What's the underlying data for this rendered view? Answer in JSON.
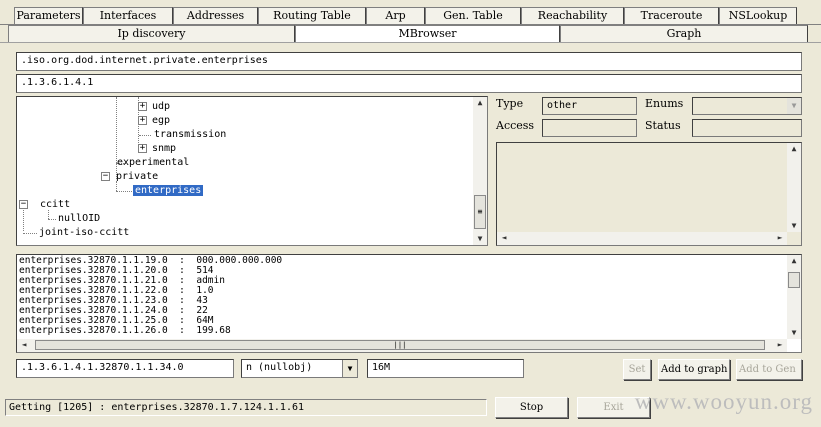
{
  "tabs_top": [
    {
      "label": "Parameters"
    },
    {
      "label": "Interfaces"
    },
    {
      "label": "Addresses"
    },
    {
      "label": "Routing Table"
    },
    {
      "label": "Arp"
    },
    {
      "label": "Gen. Table"
    },
    {
      "label": "Reachability"
    },
    {
      "label": "Traceroute"
    },
    {
      "label": "NSLookup"
    }
  ],
  "tabs_second": [
    {
      "label": "Ip discovery"
    },
    {
      "label": "MBrowser"
    },
    {
      "label": "Graph"
    }
  ],
  "oid_name": ".iso.org.dod.internet.private.enterprises",
  "oid_numeric": ".1.3.6.1.4.1",
  "tree": {
    "udp": "udp",
    "egp": "egp",
    "transmission": "transmission",
    "snmp": "snmp",
    "experimental": "experimental",
    "private": "private",
    "enterprises": "enterprises",
    "ccitt": "ccitt",
    "nullOID": "nullOID",
    "joint": "joint-iso-ccitt"
  },
  "props": {
    "type_label": "Type",
    "type_value": "other",
    "enums_label": "Enums",
    "access_label": "Access",
    "status_label": "Status"
  },
  "results": [
    {
      "oid": "enterprises.32870.1.1.19.0",
      "sep": ":",
      "value": "000.000.000.000"
    },
    {
      "oid": "enterprises.32870.1.1.20.0",
      "sep": ":",
      "value": "514"
    },
    {
      "oid": "enterprises.32870.1.1.21.0",
      "sep": ":",
      "value": "admin"
    },
    {
      "oid": "enterprises.32870.1.1.22.0",
      "sep": ":",
      "value": "1.0"
    },
    {
      "oid": "enterprises.32870.1.1.23.0",
      "sep": ":",
      "value": "43"
    },
    {
      "oid": "enterprises.32870.1.1.24.0",
      "sep": ":",
      "value": "22"
    },
    {
      "oid": "enterprises.32870.1.1.25.0",
      "sep": ":",
      "value": "64M"
    },
    {
      "oid": "enterprises.32870.1.1.26.0",
      "sep": ":",
      "value": "199.68"
    }
  ],
  "bottom": {
    "oid_input": ".1.3.6.1.4.1.32870.1.1.34.0",
    "type_select": "n (nullobj)",
    "value_input": "16M",
    "set_button": "Set",
    "add_graph_button": "Add to graph",
    "add_gen_button": "Add to Gen"
  },
  "status_text": "Getting [1205] : enterprises.32870.1.7.124.1.1.61",
  "stop_button": "Stop",
  "exit_button": "Exit",
  "watermark": "www.wooyun.org",
  "icons": {
    "scroll_up": "▲",
    "scroll_down": "▼",
    "scroll_left": "◄",
    "scroll_right": "►",
    "dropdown": "▼",
    "grip": "≡",
    "hgrip": "|||"
  }
}
